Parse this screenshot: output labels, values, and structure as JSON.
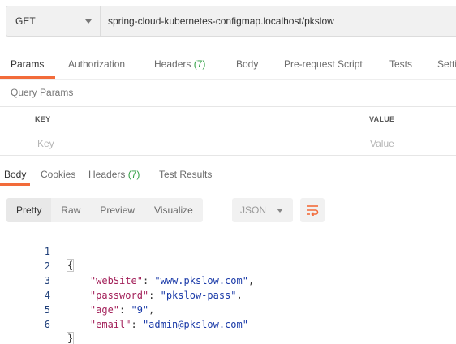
{
  "request": {
    "method": "GET",
    "url": "spring-cloud-kubernetes-configmap.localhost/pkslow"
  },
  "request_tabs": [
    {
      "label": "Params",
      "active": true
    },
    {
      "label": "Authorization"
    },
    {
      "label": "Headers",
      "badge": "(7)"
    },
    {
      "label": "Body"
    },
    {
      "label": "Pre-request Script"
    },
    {
      "label": "Tests"
    },
    {
      "label": "Setti"
    }
  ],
  "query_params": {
    "title": "Query Params",
    "key_header": "KEY",
    "value_header": "VALUE",
    "key_placeholder": "Key",
    "value_placeholder": "Value"
  },
  "response_tabs": [
    {
      "label": "Body",
      "active": true
    },
    {
      "label": "Cookies"
    },
    {
      "label": "Headers",
      "badge": "(7)"
    },
    {
      "label": "Test Results"
    }
  ],
  "view_modes": [
    "Pretty",
    "Raw",
    "Preview",
    "Visualize"
  ],
  "format": "JSON",
  "accent_color": "#f26b3a",
  "badge_color": "#2e9e41",
  "icons": {
    "method_dropdown": "chevron-down-icon",
    "format_dropdown": "chevron-down-icon",
    "wrap": "wrap-lines-icon"
  },
  "response_body": {
    "line_numbers": [
      "1",
      "2",
      "3",
      "4",
      "5",
      "6"
    ],
    "open_brace": "{",
    "close_brace": "}",
    "fields": [
      {
        "key": "\"webSite\"",
        "value": "\"www.pkslow.com\"",
        "trail": ","
      },
      {
        "key": "\"password\"",
        "value": "\"pkslow-pass\"",
        "trail": ","
      },
      {
        "key": "\"age\"",
        "value": "\"9\"",
        "trail": ","
      },
      {
        "key": "\"email\"",
        "value": "\"admin@pkslow.com\"",
        "trail": ""
      }
    ]
  }
}
